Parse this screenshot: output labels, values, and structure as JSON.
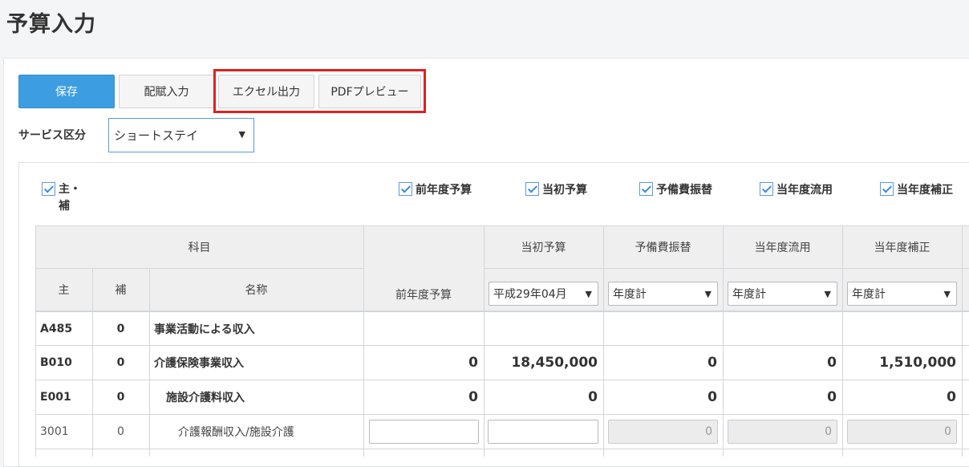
{
  "page": {
    "title": "予算入力"
  },
  "toolbar": {
    "save_label": "保存",
    "haifu_label": "配賦入力",
    "excel_label": "エクセル出力",
    "pdf_label": "PDFプレビュー"
  },
  "service": {
    "label": "サービス区分",
    "value": "ショートステイ"
  },
  "columns_visibility": [
    {
      "label": "主・\n補",
      "checked": true
    },
    {
      "label": "前年度予算",
      "checked": true
    },
    {
      "label": "当初予算",
      "checked": true
    },
    {
      "label": "予備費振替",
      "checked": true
    },
    {
      "label": "当年度流用",
      "checked": true
    },
    {
      "label": "当年度補正",
      "checked": true
    }
  ],
  "table": {
    "headers": {
      "kamoku": "科目",
      "main": "主",
      "sub": "補",
      "name": "名称",
      "prev_budget": "前年度予算",
      "initial_budget": "当初予算",
      "reserve": "予備費振替",
      "diversion": "当年度流用",
      "correction": "当年度補正"
    },
    "selectors": {
      "initial_budget": "平成29年04月",
      "reserve": "年度計",
      "diversion": "年度計",
      "correction": "年度計"
    },
    "rows": [
      {
        "main": "A485",
        "sub": "0",
        "name": "事業活動による収入",
        "prev": "",
        "initial": "",
        "reserve": "",
        "diversion": "",
        "correction": ""
      },
      {
        "main": "B010",
        "sub": "0",
        "name": "介護保険事業収入",
        "prev": "0",
        "initial": "18,450,000",
        "reserve": "0",
        "diversion": "0",
        "correction": "1,510,000"
      },
      {
        "main": "E001",
        "sub": "0",
        "name": "施設介護料収入",
        "prev": "0",
        "initial": "0",
        "reserve": "0",
        "diversion": "0",
        "correction": "0"
      },
      {
        "main": "3001",
        "sub": "0",
        "name": "介護報酬収入/施設介護",
        "prev": "",
        "initial": "",
        "reserve": "0",
        "diversion": "0",
        "correction": "0"
      }
    ]
  },
  "icons": {
    "checkbox": "check-icon",
    "dropdown": "triangle-down-icon"
  }
}
